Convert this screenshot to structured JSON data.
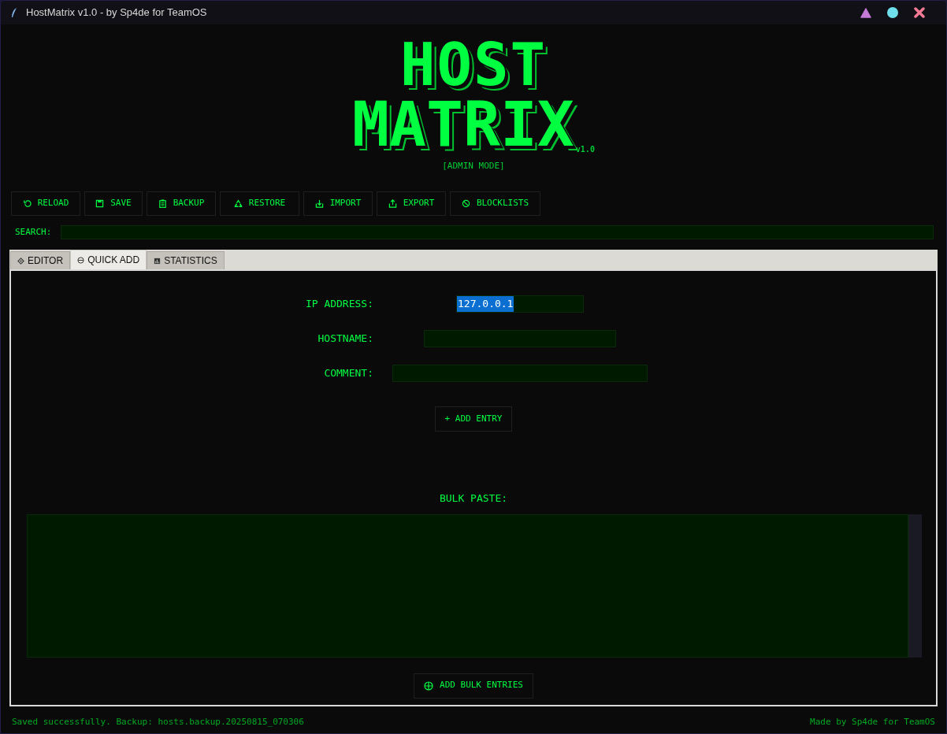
{
  "window": {
    "title": "HostMatrix v1.0 - by Sp4de for TeamOS"
  },
  "logo": {
    "lines": [
      "HOST",
      "MATRIX"
    ],
    "version": "v1.0",
    "mode": "[ADMIN MODE]"
  },
  "toolbar": [
    {
      "kind": "reload",
      "label": "RELOAD"
    },
    {
      "kind": "save",
      "label": "SAVE"
    },
    {
      "kind": "backup",
      "label": "BACKUP"
    },
    {
      "kind": "restore",
      "label": "RESTORE"
    },
    {
      "kind": "import",
      "label": "IMPORT"
    },
    {
      "kind": "export",
      "label": "EXPORT"
    },
    {
      "kind": "blocklists",
      "label": "BLOCKLISTS"
    }
  ],
  "search": {
    "label": "SEARCH:"
  },
  "tabs": [
    {
      "kind": "editor",
      "label": "EDITOR",
      "selected": false
    },
    {
      "kind": "quickadd",
      "label": "QUICK ADD",
      "selected": true
    },
    {
      "kind": "statistics",
      "label": "STATISTICS",
      "selected": false
    }
  ],
  "quick_add": {
    "fields": [
      {
        "label": "IP ADDRESS:",
        "value": "127.0.0.1",
        "text_selected": true
      },
      {
        "label": "HOSTNAME:"
      },
      {
        "label": "COMMENT:"
      }
    ],
    "add_button": "+ ADD ENTRY",
    "bulk_label": "BULK PASTE:",
    "bulk_button": "ADD BULK ENTRIES"
  },
  "status_bar": {
    "message": "Saved successfully. Backup: hosts.backup.20250815_070306",
    "credit": "Made by Sp4de for TeamOS"
  }
}
